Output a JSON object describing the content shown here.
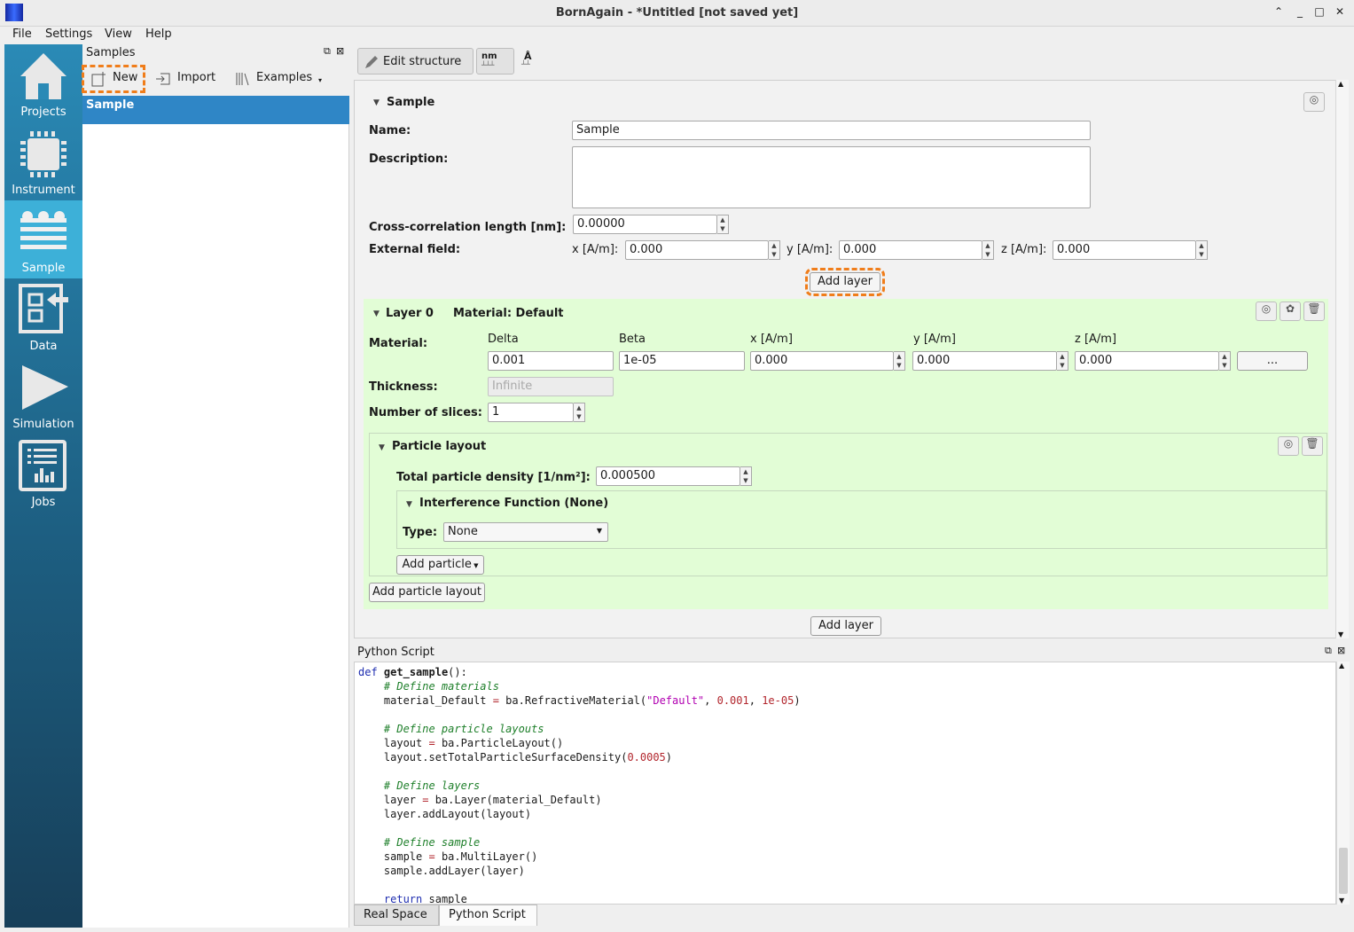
{
  "window": {
    "title": "BornAgain - *Untitled [not saved yet]"
  },
  "menu": [
    "File",
    "Settings",
    "View",
    "Help"
  ],
  "sidebar": [
    {
      "label": "Projects",
      "icon": "home-icon"
    },
    {
      "label": "Instrument",
      "icon": "chip-icon"
    },
    {
      "label": "Sample",
      "icon": "layers-icon"
    },
    {
      "label": "Data",
      "icon": "data-import-icon"
    },
    {
      "label": "Simulation",
      "icon": "play-icon"
    },
    {
      "label": "Jobs",
      "icon": "job-list-icon"
    }
  ],
  "samples_panel": {
    "title": "Samples",
    "new": "New",
    "import": "Import",
    "examples": "Examples",
    "items": [
      "Sample"
    ]
  },
  "toolbar": {
    "edit_structure": "Edit structure",
    "unit_nm": "nm",
    "unit_a": "Å"
  },
  "sample": {
    "header": "Sample",
    "name_label": "Name:",
    "name_value": "Sample",
    "description_label": "Description:",
    "description_value": "",
    "cc_label": "Cross-correlation length [nm]:",
    "cc_value": "0.00000",
    "ef_label": "External field:",
    "ef_x_label": "x [A/m]:",
    "ef_x": "0.000",
    "ef_y_label": "y [A/m]:",
    "ef_y": "0.000",
    "ef_z_label": "z [A/m]:",
    "ef_z": "0.000",
    "add_layer": "Add layer"
  },
  "layer": {
    "title": "Layer 0",
    "material_title": "Material: Default",
    "material_label": "Material:",
    "cols": [
      "Delta",
      "Beta",
      "x [A/m]",
      "y [A/m]",
      "z [A/m]"
    ],
    "delta": "0.001",
    "beta": "1e-05",
    "mx": "0.000",
    "my": "0.000",
    "mz": "0.000",
    "more": "...",
    "thickness_label": "Thickness:",
    "thickness_placeholder": "Infinite",
    "slices_label": "Number of slices:",
    "slices_value": "1"
  },
  "layout": {
    "title": "Particle layout",
    "density_label": "Total particle density [1/nm²]:",
    "density_value": "0.000500",
    "interference_title": "Interference Function (None)",
    "type_label": "Type:",
    "type_value": "None",
    "add_particle": "Add particle",
    "add_layout": "Add particle layout"
  },
  "bottom_add_layer": "Add layer",
  "script": {
    "title": "Python Script",
    "tabs": [
      "Real Space",
      "Python Script"
    ],
    "active_tab": "Python Script"
  }
}
